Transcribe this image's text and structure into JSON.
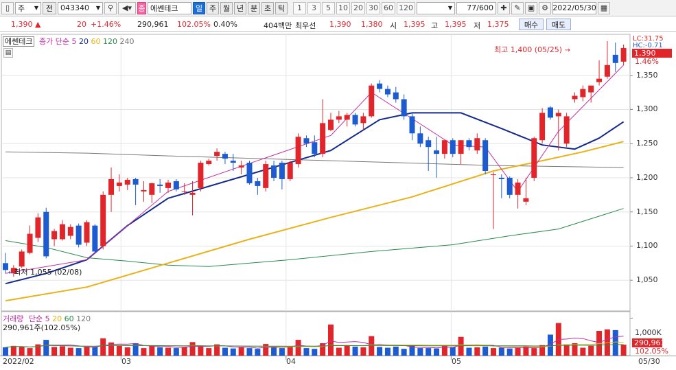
{
  "toolbar": {
    "period": "주",
    "market": "전",
    "code": "043340",
    "name_tag": "종",
    "name": "에쎈테크",
    "day": "일",
    "week": "주",
    "month": "월",
    "year": "년",
    "minute": "분",
    "second": "초",
    "tick": "틱",
    "intervals": [
      "1",
      "3",
      "5",
      "10",
      "20",
      "30",
      "60",
      "120"
    ],
    "count": "77/600",
    "date": "2022/05/30"
  },
  "quote": {
    "price": "1,390 ▲",
    "change": "20",
    "change_pct": "+1.46%",
    "volume": "290,961",
    "vol_ratio": "102.05%",
    "turnover": "0.40%",
    "amount": "404백만",
    "ask_label": "최우선",
    "ask": "1,390",
    "bid": "1,380",
    "open_label": "시",
    "open": "1,395",
    "high_label": "고",
    "high": "1,395",
    "low_label": "저",
    "low": "1,375",
    "buy_label": "매수",
    "sell_label": "매도"
  },
  "price_panel": {
    "title_box": "에쎈테크",
    "ma_title": "종가 단순",
    "ma_periods": [
      "5",
      "20",
      "60",
      "120",
      "240"
    ],
    "high_note": "최고 1,400 (05/25)",
    "low_note": "최저 1,055 (02/08)",
    "lc": "LC:31.75",
    "hc": "HC:-0.71",
    "last_price": "1,390",
    "last_pct": "1.46%",
    "y_ticks": [
      "1,350",
      "1,300",
      "1,250",
      "1,200",
      "1,150",
      "1,100",
      "1,050"
    ]
  },
  "volume_panel": {
    "title": "거래량",
    "ma_title": "단순",
    "ma_periods": [
      "5",
      "20",
      "60",
      "120"
    ],
    "value": "290,961주(102.05%)",
    "y_tick": "1,000K",
    "last_volume": "290,961",
    "last_pct": "102.05%"
  },
  "x_axis": {
    "labels": [
      "2022/02",
      "03",
      "04",
      "05"
    ],
    "last": "05/30"
  },
  "colors": {
    "up": "#e0262b",
    "down": "#1d5bd0",
    "ma5": "#c02fa5",
    "ma20": "#132a8c",
    "ma60": "#e8b21a",
    "ma120": "#2b8a4a",
    "ma240": "#777777"
  },
  "chart_data": {
    "type": "candlestick",
    "price_ylim": [
      1005,
      1410
    ],
    "candles": [
      {
        "o": 1075,
        "h": 1090,
        "l": 1060,
        "c": 1065
      },
      {
        "o": 1060,
        "h": 1072,
        "l": 1055,
        "c": 1068
      },
      {
        "o": 1070,
        "h": 1095,
        "l": 1068,
        "c": 1092
      },
      {
        "o": 1090,
        "h": 1130,
        "l": 1088,
        "c": 1118
      },
      {
        "o": 1112,
        "h": 1148,
        "l": 1106,
        "c": 1142
      },
      {
        "o": 1150,
        "h": 1156,
        "l": 1082,
        "c": 1085
      },
      {
        "o": 1110,
        "h": 1125,
        "l": 1100,
        "c": 1122
      },
      {
        "o": 1110,
        "h": 1138,
        "l": 1108,
        "c": 1132
      },
      {
        "o": 1115,
        "h": 1132,
        "l": 1110,
        "c": 1128
      },
      {
        "o": 1130,
        "h": 1133,
        "l": 1098,
        "c": 1102
      },
      {
        "o": 1105,
        "h": 1138,
        "l": 1100,
        "c": 1135
      },
      {
        "o": 1130,
        "h": 1132,
        "l": 1090,
        "c": 1092
      },
      {
        "o": 1100,
        "h": 1180,
        "l": 1095,
        "c": 1175
      },
      {
        "o": 1175,
        "h": 1215,
        "l": 1150,
        "c": 1198
      },
      {
        "o": 1188,
        "h": 1205,
        "l": 1180,
        "c": 1193
      },
      {
        "o": 1190,
        "h": 1200,
        "l": 1182,
        "c": 1197
      },
      {
        "o": 1198,
        "h": 1200,
        "l": 1160,
        "c": 1190
      },
      {
        "o": 1180,
        "h": 1195,
        "l": 1165,
        "c": 1182
      },
      {
        "o": 1175,
        "h": 1193,
        "l": 1163,
        "c": 1192
      },
      {
        "o": 1190,
        "h": 1198,
        "l": 1178,
        "c": 1188
      },
      {
        "o": 1185,
        "h": 1197,
        "l": 1178,
        "c": 1193
      },
      {
        "o": 1195,
        "h": 1198,
        "l": 1180,
        "c": 1183
      },
      {
        "o": 1180,
        "h": 1192,
        "l": 1175,
        "c": 1180
      },
      {
        "o": 1175,
        "h": 1195,
        "l": 1145,
        "c": 1178
      },
      {
        "o": 1185,
        "h": 1225,
        "l": 1180,
        "c": 1222
      },
      {
        "o": 1220,
        "h": 1228,
        "l": 1218,
        "c": 1225
      },
      {
        "o": 1232,
        "h": 1243,
        "l": 1225,
        "c": 1238
      },
      {
        "o": 1235,
        "h": 1238,
        "l": 1220,
        "c": 1228
      },
      {
        "o": 1225,
        "h": 1235,
        "l": 1210,
        "c": 1222
      },
      {
        "o": 1215,
        "h": 1225,
        "l": 1205,
        "c": 1218
      },
      {
        "o": 1222,
        "h": 1225,
        "l": 1190,
        "c": 1192
      },
      {
        "o": 1195,
        "h": 1200,
        "l": 1175,
        "c": 1188
      },
      {
        "o": 1185,
        "h": 1225,
        "l": 1180,
        "c": 1220
      },
      {
        "o": 1218,
        "h": 1225,
        "l": 1195,
        "c": 1200
      },
      {
        "o": 1222,
        "h": 1225,
        "l": 1183,
        "c": 1198
      },
      {
        "o": 1198,
        "h": 1225,
        "l": 1195,
        "c": 1222
      },
      {
        "o": 1220,
        "h": 1265,
        "l": 1215,
        "c": 1260
      },
      {
        "o": 1258,
        "h": 1262,
        "l": 1245,
        "c": 1250
      },
      {
        "o": 1252,
        "h": 1262,
        "l": 1230,
        "c": 1235
      },
      {
        "o": 1235,
        "h": 1315,
        "l": 1230,
        "c": 1280
      },
      {
        "o": 1270,
        "h": 1295,
        "l": 1268,
        "c": 1285
      },
      {
        "o": 1285,
        "h": 1298,
        "l": 1280,
        "c": 1290
      },
      {
        "o": 1285,
        "h": 1295,
        "l": 1275,
        "c": 1292
      },
      {
        "o": 1292,
        "h": 1295,
        "l": 1275,
        "c": 1278
      },
      {
        "o": 1280,
        "h": 1295,
        "l": 1270,
        "c": 1290
      },
      {
        "o": 1290,
        "h": 1338,
        "l": 1288,
        "c": 1335
      },
      {
        "o": 1338,
        "h": 1343,
        "l": 1325,
        "c": 1330
      },
      {
        "o": 1330,
        "h": 1335,
        "l": 1318,
        "c": 1322
      },
      {
        "o": 1325,
        "h": 1333,
        "l": 1310,
        "c": 1315
      },
      {
        "o": 1315,
        "h": 1322,
        "l": 1285,
        "c": 1290
      },
      {
        "o": 1290,
        "h": 1295,
        "l": 1255,
        "c": 1265
      },
      {
        "o": 1265,
        "h": 1275,
        "l": 1245,
        "c": 1250
      },
      {
        "o": 1255,
        "h": 1260,
        "l": 1210,
        "c": 1245
      },
      {
        "o": 1240,
        "h": 1260,
        "l": 1200,
        "c": 1235
      },
      {
        "o": 1235,
        "h": 1255,
        "l": 1228,
        "c": 1255
      },
      {
        "o": 1255,
        "h": 1258,
        "l": 1230,
        "c": 1235
      },
      {
        "o": 1235,
        "h": 1255,
        "l": 1220,
        "c": 1255
      },
      {
        "o": 1255,
        "h": 1258,
        "l": 1240,
        "c": 1245
      },
      {
        "o": 1240,
        "h": 1265,
        "l": 1235,
        "c": 1258
      },
      {
        "o": 1255,
        "h": 1258,
        "l": 1205,
        "c": 1210
      },
      {
        "o": 1205,
        "h": 1208,
        "l": 1125,
        "c": 1205
      },
      {
        "o": 1200,
        "h": 1205,
        "l": 1170,
        "c": 1198
      },
      {
        "o": 1200,
        "h": 1202,
        "l": 1170,
        "c": 1175
      },
      {
        "o": 1175,
        "h": 1198,
        "l": 1155,
        "c": 1193
      },
      {
        "o": 1165,
        "h": 1200,
        "l": 1160,
        "c": 1170
      },
      {
        "o": 1200,
        "h": 1260,
        "l": 1195,
        "c": 1258
      },
      {
        "o": 1255,
        "h": 1302,
        "l": 1250,
        "c": 1295
      },
      {
        "o": 1303,
        "h": 1305,
        "l": 1285,
        "c": 1288
      },
      {
        "o": 1290,
        "h": 1300,
        "l": 1240,
        "c": 1295
      },
      {
        "o": 1250,
        "h": 1295,
        "l": 1245,
        "c": 1290
      },
      {
        "o": 1315,
        "h": 1325,
        "l": 1310,
        "c": 1320
      },
      {
        "o": 1318,
        "h": 1335,
        "l": 1312,
        "c": 1330
      },
      {
        "o": 1325,
        "h": 1330,
        "l": 1310,
        "c": 1335
      },
      {
        "o": 1340,
        "h": 1372,
        "l": 1335,
        "c": 1345
      },
      {
        "o": 1348,
        "h": 1400,
        "l": 1345,
        "c": 1365
      },
      {
        "o": 1380,
        "h": 1398,
        "l": 1355,
        "c": 1368
      },
      {
        "o": 1370,
        "h": 1395,
        "l": 1365,
        "c": 1390
      }
    ],
    "ma5": [
      [
        0,
        1060
      ],
      [
        10,
        1080
      ],
      [
        20,
        1180
      ],
      [
        40,
        1262
      ],
      [
        45,
        1325
      ],
      [
        55,
        1248
      ],
      [
        59,
        1245
      ],
      [
        63,
        1180
      ],
      [
        68,
        1268
      ],
      [
        76,
        1365
      ]
    ],
    "ma20": [
      [
        0,
        1045
      ],
      [
        5,
        1060
      ],
      [
        10,
        1080
      ],
      [
        15,
        1130
      ],
      [
        20,
        1170
      ],
      [
        30,
        1205
      ],
      [
        40,
        1240
      ],
      [
        46,
        1285
      ],
      [
        50,
        1295
      ],
      [
        56,
        1295
      ],
      [
        61,
        1272
      ],
      [
        66,
        1248
      ],
      [
        70,
        1242
      ],
      [
        73,
        1258
      ],
      [
        76,
        1282
      ]
    ],
    "ma60": [
      [
        0,
        1020
      ],
      [
        10,
        1040
      ],
      [
        20,
        1075
      ],
      [
        30,
        1110
      ],
      [
        40,
        1142
      ],
      [
        50,
        1172
      ],
      [
        60,
        1210
      ],
      [
        66,
        1225
      ],
      [
        71,
        1238
      ],
      [
        76,
        1253
      ]
    ],
    "ma120": [
      [
        0,
        1108
      ],
      [
        5,
        1098
      ],
      [
        10,
        1083
      ],
      [
        15,
        1078
      ],
      [
        20,
        1072
      ],
      [
        25,
        1070
      ],
      [
        35,
        1080
      ],
      [
        45,
        1092
      ],
      [
        55,
        1102
      ],
      [
        62,
        1115
      ],
      [
        68,
        1125
      ],
      [
        76,
        1155
      ]
    ],
    "ma240": [
      [
        0,
        1238
      ],
      [
        10,
        1236
      ],
      [
        20,
        1232
      ],
      [
        40,
        1225
      ],
      [
        60,
        1218
      ],
      [
        76,
        1215
      ]
    ],
    "volume": [
      220,
      260,
      240,
      200,
      300,
      420,
      230,
      250,
      210,
      200,
      240,
      230,
      460,
      350,
      260,
      220,
      330,
      200,
      260,
      220,
      210,
      200,
      230,
      360,
      240,
      200,
      300,
      210,
      190,
      220,
      200,
      180,
      310,
      220,
      200,
      230,
      420,
      200,
      180,
      330,
      830,
      210,
      260,
      240,
      220,
      520,
      230,
      210,
      240,
      180,
      260,
      200,
      200,
      190,
      270,
      230,
      500,
      210,
      220,
      240,
      200,
      210,
      190,
      220,
      240,
      200,
      280,
      560,
      870,
      300,
      330,
      210,
      260,
      660,
      700,
      680,
      291
    ],
    "volume_ylim": [
      0,
      1100
    ]
  }
}
